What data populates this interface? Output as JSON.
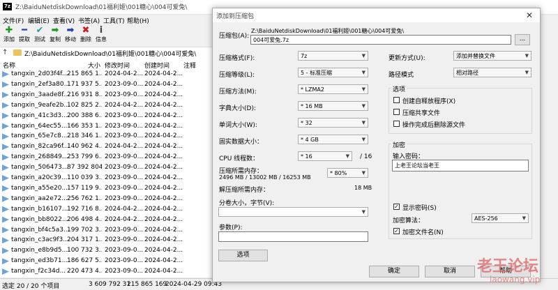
{
  "window": {
    "app_icon_text": "7z",
    "title": "Z:\\BaiduNetdiskDownload\\01福利姬\\001糖心\\004可爱兔\\"
  },
  "menu": [
    "文件(F)",
    "编辑(E)",
    "查看(V)",
    "书签(A)",
    "工具(T)",
    "帮助(H)"
  ],
  "toolbar": [
    {
      "label": "添加",
      "icon": "plus-icon",
      "glyph": "✚",
      "color": "#1a9a1a"
    },
    {
      "label": "提取",
      "icon": "minus-icon",
      "glyph": "━",
      "color": "#1b3fb5"
    },
    {
      "label": "测试",
      "icon": "checkmark-icon",
      "glyph": "✔",
      "color": "#1fa0a0"
    },
    {
      "label": "复制",
      "icon": "copy-arrow-icon",
      "glyph": "➡",
      "color": "#1a9a1a"
    },
    {
      "label": "移动",
      "icon": "move-arrow-icon",
      "glyph": "➡",
      "color": "#1b3fb5"
    },
    {
      "label": "删除",
      "icon": "delete-icon",
      "glyph": "✖",
      "color": "#c81e1e"
    },
    {
      "label": "信息",
      "icon": "info-icon",
      "glyph": "i",
      "color": "#444444"
    }
  ],
  "address": {
    "path": "Z:\\BaiduNetdiskDownload\\01福利姬\\001糖心\\004可爱兔\\"
  },
  "file_list": {
    "headers": {
      "name": "名称",
      "size": "大小",
      "modified": "修改时间",
      "created": "创建时间",
      "comment": "注释"
    },
    "rows": [
      {
        "name": "tangxin_2d03f4f...",
        "size": "215 865 1...",
        "modified": "2024-04-2...",
        "created": "2024-04-2..."
      },
      {
        "name": "tangxin_2ef3a80...",
        "size": "171 937 5...",
        "modified": "2023-09-0...",
        "created": "2024-04-2..."
      },
      {
        "name": "tangxin_3aade8f...",
        "size": "216 931 8...",
        "modified": "2023-09-0...",
        "created": "2024-04-2..."
      },
      {
        "name": "tangxin_9eafe2b...",
        "size": "102 825 2...",
        "modified": "2024-04-2...",
        "created": "2024-04-2..."
      },
      {
        "name": "tangxin_41c3d3...",
        "size": "200 388 6...",
        "modified": "2023-09-0...",
        "created": "2024-04-2..."
      },
      {
        "name": "tangxin_64ec55...",
        "size": "166 353 1...",
        "modified": "2023-09-0...",
        "created": "2024-04-2..."
      },
      {
        "name": "tangxin_65e7c8...",
        "size": "218 346 1...",
        "modified": "2023-09-0...",
        "created": "2024-04-2..."
      },
      {
        "name": "tangxin_82ca96f...",
        "size": "140 962 4...",
        "modified": "2024-04-2...",
        "created": "2024-04-2..."
      },
      {
        "name": "tangxin_268849...",
        "size": "253 799 6...",
        "modified": "2023-09-0...",
        "created": "2024-04-2..."
      },
      {
        "name": "tangxin_506473...",
        "size": "87 392 804",
        "modified": "2023-09-0...",
        "created": "2024-04-2..."
      },
      {
        "name": "tangxin_a20c39...",
        "size": "110 039 3...",
        "modified": "2023-09-0...",
        "created": "2024-04-2..."
      },
      {
        "name": "tangxin_a55e20...",
        "size": "157 119 9...",
        "modified": "2023-09-0...",
        "created": "2024-04-2..."
      },
      {
        "name": "tangxin_aa2e72...",
        "size": "256 762 1...",
        "modified": "2023-09-0...",
        "created": "2024-04-2..."
      },
      {
        "name": "tangxin_b16107...",
        "size": "192 716 8...",
        "modified": "2024-04-2...",
        "created": "2024-04-2..."
      },
      {
        "name": "tangxin_bb8022...",
        "size": "206 498 4...",
        "modified": "2024-04-2...",
        "created": "2024-04-2..."
      },
      {
        "name": "tangxin_bf4c5a3...",
        "size": "199 702 3...",
        "modified": "2023-09-0...",
        "created": "2024-04-2..."
      },
      {
        "name": "tangxin_c3ac9f3...",
        "size": "204 317 1...",
        "modified": "2023-09-0...",
        "created": "2024-04-2..."
      },
      {
        "name": "tangxin_e8b9d5...",
        "size": "100 732 3...",
        "modified": "2023-09-0...",
        "created": "2024-04-2..."
      },
      {
        "name": "tangxin_ed3b71...",
        "size": "186 627 5...",
        "modified": "2023-09-0...",
        "created": "2024-04-2..."
      },
      {
        "name": "tangxin_f2c34d...",
        "size": "220 473 4...",
        "modified": "2023-09-0...",
        "created": "2024-04-2..."
      }
    ]
  },
  "status": {
    "selection": "选定 20 / 20 个项目",
    "total_size": "3 609 792 31",
    "selected_size": "215 865 169",
    "timestamp": "2024-04-29 09:43"
  },
  "dialog": {
    "title": "添加到压缩包",
    "archive_label": "压缩包(A):",
    "archive_dir": "Z:\\BaiduNetdiskDownload\\01福利姬\\001糖心\\004可爱兔\\",
    "archive_name": "004可爱兔.7z",
    "browse_label": "...",
    "format_label": "压缩格式(F):",
    "format_value": "7z",
    "level_label": "压缩等级(L):",
    "level_value": "5 - 标准压缩",
    "method_label": "压缩方法(M):",
    "method_value": "* LZMA2",
    "dict_label": "字典大小(D):",
    "dict_value": "* 16 MB",
    "word_label": "单词大小(W):",
    "word_value": "* 32",
    "solid_label": "固实数据大小：",
    "solid_value": "* 4 GB",
    "threads_label": "CPU 线程数：",
    "threads_value": "* 16",
    "threads_total": "/ 16",
    "mem_compress_label": "压缩所需内存：",
    "mem_compress_detail": "2496 MB / 13002 MB / 16253 MB",
    "mem_percent_value": "* 80%",
    "mem_decompress_label": "解压缩所需内存：",
    "mem_decompress_value": "18 MB",
    "split_label": "分卷大小，字节(V):",
    "split_value": "",
    "params_label": "参数(P):",
    "params_value": "",
    "options_button": "选项",
    "update_label": "更新方式(U):",
    "update_value": "添加并替换文件",
    "path_mode_label": "路径模式",
    "path_mode_value": "相对路径",
    "options_group_label": "选项",
    "opt_sfx": "创建自释放程序(X)",
    "opt_shared": "压缩共享文件",
    "opt_delete": "操作完成后删除源文件",
    "encrypt_group_label": "加密",
    "password_label": "输入密码：",
    "password_value": "上老王论坛当老王",
    "show_password": "显示密码(S)",
    "enc_method_label": "加密算法：",
    "enc_method_value": "AES-256",
    "encrypt_names": "加密文件名(N)",
    "ok": "确定",
    "cancel": "取消",
    "help": "帮助"
  },
  "watermark": {
    "main": "老王论坛",
    "sub": "laowang.vip"
  }
}
